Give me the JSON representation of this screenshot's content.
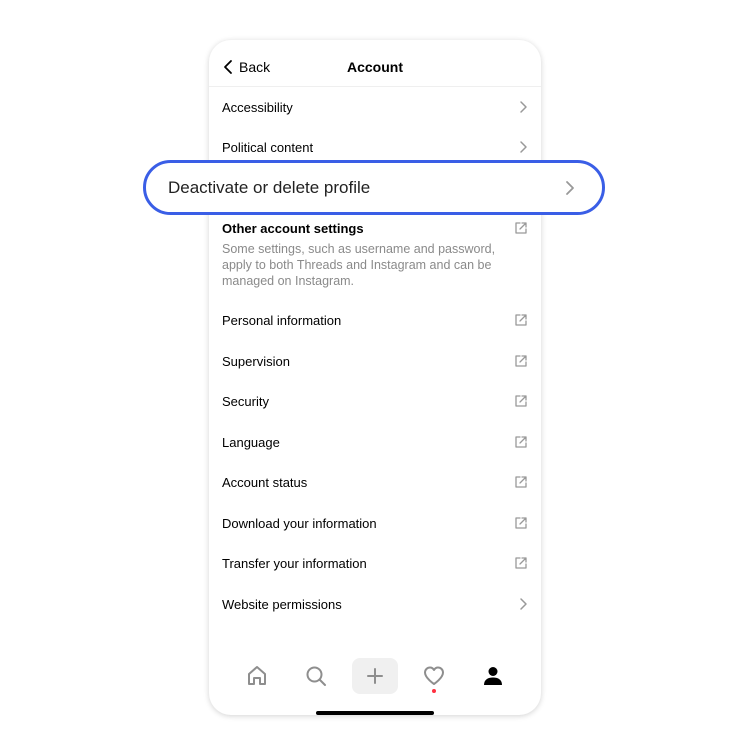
{
  "header": {
    "back_label": "Back",
    "title": "Account"
  },
  "rows_top": [
    {
      "label": "Accessibility",
      "icon": "chevron-right-icon"
    },
    {
      "label": "Political content",
      "icon": "chevron-right-icon"
    }
  ],
  "highlight": {
    "label": "Deactivate or delete profile",
    "icon": "chevron-right-icon",
    "border_color": "#3a5ee6"
  },
  "other_settings": {
    "heading": "Other account settings",
    "description": "Some settings, such as username and password, apply to both Threads and Instagram and can be managed on Instagram."
  },
  "rows_bottom": [
    {
      "label": "Personal information",
      "icon": "external-link-icon"
    },
    {
      "label": "Supervision",
      "icon": "external-link-icon"
    },
    {
      "label": "Security",
      "icon": "external-link-icon"
    },
    {
      "label": "Language",
      "icon": "external-link-icon"
    },
    {
      "label": "Account status",
      "icon": "external-link-icon"
    },
    {
      "label": "Download your information",
      "icon": "external-link-icon"
    },
    {
      "label": "Transfer your information",
      "icon": "external-link-icon"
    },
    {
      "label": "Website permissions",
      "icon": "chevron-right-icon"
    }
  ],
  "tabbar": [
    "home-icon",
    "search-icon",
    "plus-icon",
    "heart-icon",
    "profile-icon"
  ],
  "colors": {
    "notification_dot": "#ff3040"
  }
}
